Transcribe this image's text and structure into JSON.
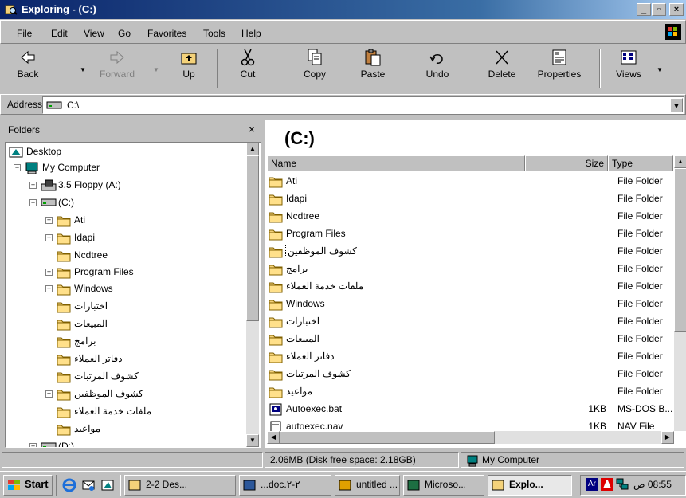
{
  "window": {
    "title": "Exploring - (C:)",
    "controls": {
      "minimize": "_",
      "maximize": "▫",
      "close": "×"
    }
  },
  "menu": [
    "File",
    "Edit",
    "View",
    "Go",
    "Favorites",
    "Tools",
    "Help"
  ],
  "toolbar": [
    {
      "label": "Back",
      "icon": "back-arrow-icon",
      "enabled": true,
      "dropdown": true
    },
    {
      "label": "Forward",
      "icon": "forward-arrow-icon",
      "enabled": false,
      "dropdown": true
    },
    {
      "label": "Up",
      "icon": "up-folder-icon",
      "enabled": true
    },
    {
      "label": "Cut",
      "icon": "scissors-icon",
      "enabled": true
    },
    {
      "label": "Copy",
      "icon": "copy-icon",
      "enabled": true
    },
    {
      "label": "Paste",
      "icon": "paste-icon",
      "enabled": true
    },
    {
      "label": "Undo",
      "icon": "undo-icon",
      "enabled": true
    },
    {
      "label": "Delete",
      "icon": "delete-x-icon",
      "enabled": true
    },
    {
      "label": "Properties",
      "icon": "properties-icon",
      "enabled": true
    },
    {
      "label": "Views",
      "icon": "views-icon",
      "enabled": true,
      "dropdown": true
    }
  ],
  "address": {
    "label": "Address",
    "value": "C:\\"
  },
  "folders_pane": {
    "title": "Folders",
    "close": "×",
    "tree": [
      {
        "label": "Desktop",
        "icon": "desktop-icon"
      },
      {
        "label": "My Computer",
        "icon": "computer-icon",
        "expander": "-"
      },
      {
        "label": "3.5 Floppy (A:)",
        "icon": "floppy-drive-icon",
        "expander": "+"
      },
      {
        "label": "(C:)",
        "icon": "hard-drive-icon",
        "expander": "-"
      },
      {
        "label": "Ati",
        "icon": "folder-icon",
        "expander": "+"
      },
      {
        "label": "Idapi",
        "icon": "folder-icon",
        "expander": "+"
      },
      {
        "label": "Ncdtree",
        "icon": "folder-icon"
      },
      {
        "label": "Program Files",
        "icon": "folder-icon",
        "expander": "+"
      },
      {
        "label": "Windows",
        "icon": "folder-icon",
        "expander": "+"
      },
      {
        "label": "اختبارات",
        "icon": "folder-icon"
      },
      {
        "label": "المبيعات",
        "icon": "folder-icon"
      },
      {
        "label": "برامج",
        "icon": "folder-icon"
      },
      {
        "label": "دفاتر العملاء",
        "icon": "folder-icon"
      },
      {
        "label": "كشوف المرتبات",
        "icon": "folder-icon"
      },
      {
        "label": "كشوف الموظفين",
        "icon": "folder-icon",
        "expander": "+"
      },
      {
        "label": "ملفات خدمة العملاء",
        "icon": "folder-icon"
      },
      {
        "label": "مواعيد",
        "icon": "folder-icon"
      },
      {
        "label": "(D:)",
        "icon": "hard-drive-icon",
        "expander": "+"
      }
    ]
  },
  "content": {
    "title": "(C:)",
    "columns": {
      "name": "Name",
      "size": "Size",
      "type": "Type"
    },
    "rows": [
      {
        "name": "Ati",
        "size": "",
        "type": "File Folder",
        "icon": "folder-icon"
      },
      {
        "name": "Idapi",
        "size": "",
        "type": "File Folder",
        "icon": "folder-icon"
      },
      {
        "name": "Ncdtree",
        "size": "",
        "type": "File Folder",
        "icon": "folder-icon"
      },
      {
        "name": "Program Files",
        "size": "",
        "type": "File Folder",
        "icon": "folder-icon"
      },
      {
        "name": "كشوف الموظفين",
        "size": "",
        "type": "File Folder",
        "icon": "folder-icon",
        "focused": true
      },
      {
        "name": "برامج",
        "size": "",
        "type": "File Folder",
        "icon": "folder-icon"
      },
      {
        "name": "ملفات خدمة العملاء",
        "size": "",
        "type": "File Folder",
        "icon": "folder-icon"
      },
      {
        "name": "Windows",
        "size": "",
        "type": "File Folder",
        "icon": "folder-icon"
      },
      {
        "name": "اختبارات",
        "size": "",
        "type": "File Folder",
        "icon": "folder-icon"
      },
      {
        "name": "المبيعات",
        "size": "",
        "type": "File Folder",
        "icon": "folder-icon"
      },
      {
        "name": "دفاتر العملاء",
        "size": "",
        "type": "File Folder",
        "icon": "folder-icon"
      },
      {
        "name": "كشوف المرتبات",
        "size": "",
        "type": "File Folder",
        "icon": "folder-icon"
      },
      {
        "name": "مواعيد",
        "size": "",
        "type": "File Folder",
        "icon": "folder-icon"
      },
      {
        "name": "Autoexec.bat",
        "size": "1KB",
        "type": "MS-DOS B...",
        "icon": "batch-file-icon"
      },
      {
        "name": "autoexec.nav",
        "size": "1KB",
        "type": "NAV File",
        "icon": "file-icon"
      }
    ]
  },
  "statusbar": {
    "space": "2.06MB (Disk free space: 2.18GB)",
    "location": "My Computer"
  },
  "taskbar": {
    "start": "Start",
    "buttons": [
      {
        "label": "2-2 Des...",
        "icon": "folder-icon",
        "active": false
      },
      {
        "label": "...doc.٢-٢",
        "icon": "word-icon",
        "active": false
      },
      {
        "label": "untitled ...",
        "icon": "paint-icon",
        "active": false
      },
      {
        "label": "Microso...",
        "icon": "excel-icon",
        "active": false
      },
      {
        "label": "Explo...",
        "icon": "explorer-icon",
        "active": true
      }
    ],
    "clock": "08:55 ص"
  },
  "colors": {
    "title_start": "#0a246a",
    "title_end": "#a6caf0",
    "folder": "#f4d27a",
    "face": "#c0c0c0"
  }
}
